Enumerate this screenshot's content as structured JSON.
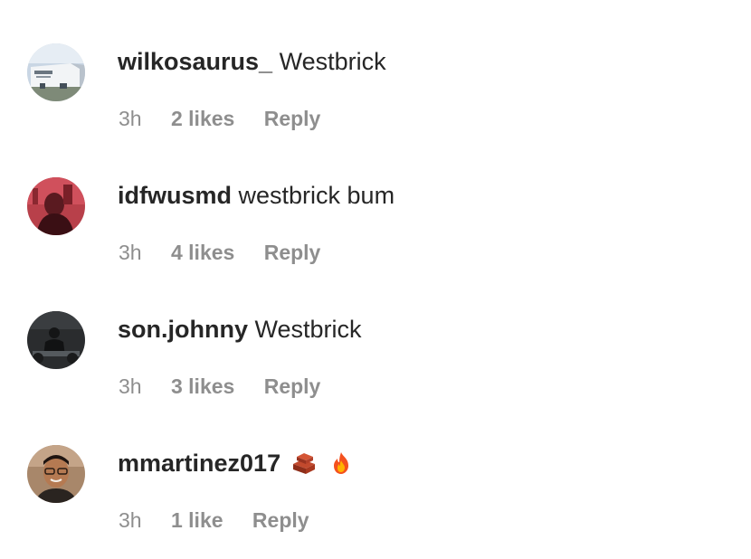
{
  "comments": [
    {
      "username": "wilkosaurus_",
      "text": "Westbrick",
      "time": "3h",
      "likes": "2 likes",
      "reply": "Reply",
      "avatar_icon": "building-photo-avatar"
    },
    {
      "username": "idfwusmd",
      "text": "westbrick bum",
      "time": "3h",
      "likes": "4 likes",
      "reply": "Reply",
      "avatar_icon": "red-tinted-photo-avatar"
    },
    {
      "username": "son.johnny",
      "text": "Westbrick",
      "time": "3h",
      "likes": "3 likes",
      "reply": "Reply",
      "avatar_icon": "dark-gym-photo-avatar"
    },
    {
      "username": "mmartinez017",
      "text": "",
      "emojis": [
        "brick-emoji",
        "fire-emoji"
      ],
      "time": "3h",
      "likes": "1 like",
      "reply": "Reply",
      "avatar_icon": "selfie-photo-avatar"
    }
  ],
  "colors": {
    "primary_text": "#262626",
    "secondary_text": "#8e8e8e",
    "background": "#ffffff"
  }
}
